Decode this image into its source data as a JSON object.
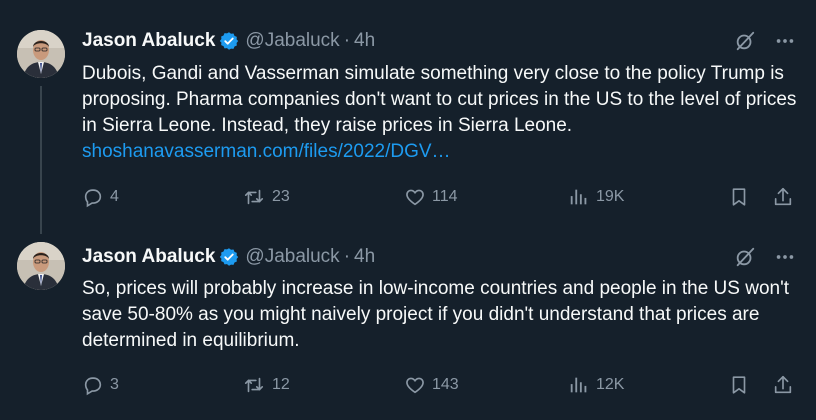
{
  "tweets": [
    {
      "author": "Jason Abaluck",
      "handle": "@Jabaluck",
      "separator": "·",
      "time": "4h",
      "text": "Dubois, Gandi and Vasserman simulate something very close to the policy Trump is proposing. Pharma companies don't want to cut prices in the US to the level of prices in Sierra Leone. Instead, they raise prices in Sierra Leone.",
      "link": "shoshanavasserman.com/files/2022/DGV…",
      "replies": "4",
      "reposts": "23",
      "likes": "114",
      "views": "19K"
    },
    {
      "author": "Jason Abaluck",
      "handle": "@Jabaluck",
      "separator": "·",
      "time": "4h",
      "text": "So, prices will probably increase in low-income countries and people in the US won't save 50-80% as you might naively project if you didn't understand that prices are determined in equilibrium.",
      "link": "",
      "replies": "3",
      "reposts": "12",
      "likes": "143",
      "views": "12K"
    }
  ],
  "colors": {
    "background": "#15202b",
    "text": "#f7f9f9",
    "muted": "#8b98a5",
    "link": "#1d9bf0",
    "verified": "#1d9bf0"
  },
  "icons": {
    "verified": "verified-badge-icon",
    "grok": "grok-icon",
    "more": "more-icon",
    "reply": "reply-icon",
    "repost": "repost-icon",
    "like": "like-icon",
    "views": "views-icon",
    "bookmark": "bookmark-icon",
    "share": "share-icon"
  }
}
